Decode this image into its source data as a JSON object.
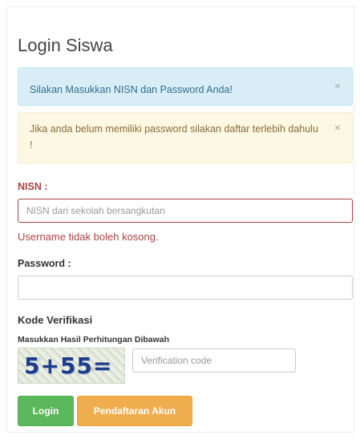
{
  "page": {
    "title": "Login Siswa"
  },
  "alerts": {
    "info": {
      "message": "Silakan Masukkan NISN dan Password Anda!",
      "close": "×"
    },
    "warning": {
      "message": "Jika anda belum memiliki password silakan daftar terlebih dahulu !",
      "close": "×"
    }
  },
  "form": {
    "nisn": {
      "label": "NISN :",
      "placeholder": "NISN dari sekolah bersangkutan",
      "value": "",
      "error": "Username tidak boleh kosong."
    },
    "password": {
      "label": "Password :",
      "value": ""
    },
    "verification": {
      "heading": "Kode Verifikasi",
      "instruction": "Masukkan Hasil Perhitungan Dibawah",
      "captcha_text": "5+55=",
      "placeholder": "Verification code",
      "value": ""
    }
  },
  "buttons": {
    "login": "Login",
    "register": "Pendaftaran Akun"
  },
  "colors": {
    "success": "#5cb85c",
    "warning": "#f0ad4e",
    "error": "#a94442",
    "info_bg": "#d9edf7",
    "warning_bg": "#fcf8e3"
  }
}
